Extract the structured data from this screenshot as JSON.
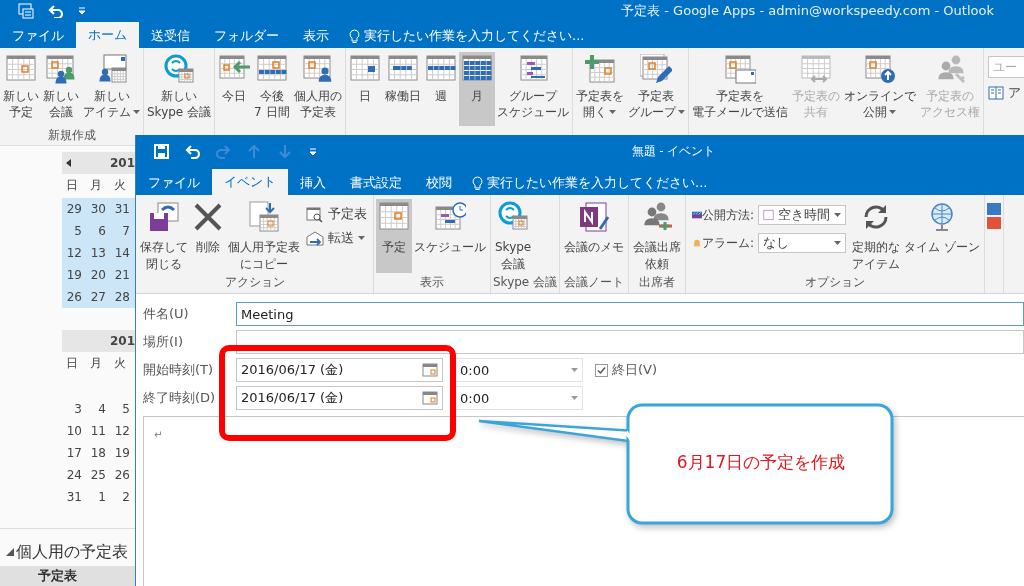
{
  "app_window": {
    "title": "予定表 - Google Apps - admin@workspeedy.com - Outlook",
    "tabs": [
      {
        "label": "ファイル",
        "selected": false
      },
      {
        "label": "ホーム",
        "selected": true
      },
      {
        "label": "送受信",
        "selected": false
      },
      {
        "label": "フォルダー",
        "selected": false
      },
      {
        "label": "表示",
        "selected": false
      }
    ],
    "tell_me": "実行したい作業を入力してください...",
    "ribbon_groups": [
      {
        "label": "新規作成",
        "buttons": [
          {
            "lines": [
              "新しい",
              "予定"
            ],
            "dropdown": false,
            "selected": false,
            "disabled": false
          },
          {
            "lines": [
              "新しい",
              "会議"
            ],
            "dropdown": false,
            "selected": false,
            "disabled": false
          },
          {
            "lines": [
              "新しい",
              "アイテム"
            ],
            "dropdown": true,
            "selected": false,
            "disabled": false
          }
        ]
      },
      {
        "buttons": [
          {
            "lines": [
              "新しい",
              "Skype 会議"
            ],
            "dropdown": false,
            "selected": false,
            "disabled": false
          }
        ]
      },
      {
        "buttons": [
          {
            "lines": [
              "今日"
            ],
            "dropdown": false,
            "selected": false,
            "disabled": false
          },
          {
            "lines": [
              "今後",
              "7 日間"
            ],
            "dropdown": false,
            "selected": false,
            "disabled": false
          },
          {
            "lines": [
              "個人用の",
              "予定表"
            ],
            "dropdown": false,
            "selected": false,
            "disabled": false
          }
        ]
      },
      {
        "buttons": [
          {
            "lines": [
              "日"
            ],
            "dropdown": false,
            "selected": false,
            "disabled": false
          },
          {
            "lines": [
              "稼働日"
            ],
            "dropdown": false,
            "selected": false,
            "disabled": false
          },
          {
            "lines": [
              "週"
            ],
            "dropdown": false,
            "selected": false,
            "disabled": false
          },
          {
            "lines": [
              "月"
            ],
            "dropdown": false,
            "selected": true,
            "disabled": false
          },
          {
            "lines": [
              "グループ",
              "スケジュール"
            ],
            "dropdown": false,
            "selected": false,
            "disabled": false
          }
        ]
      },
      {
        "buttons": [
          {
            "lines": [
              "予定表を",
              "開く"
            ],
            "dropdown": true,
            "selected": false,
            "disabled": false
          },
          {
            "lines": [
              "予定表",
              "グループ"
            ],
            "dropdown": true,
            "selected": false,
            "disabled": false
          }
        ]
      },
      {
        "buttons": [
          {
            "lines": [
              "予定表を",
              "電子メールで送信"
            ],
            "dropdown": false,
            "selected": false,
            "disabled": false
          },
          {
            "lines": [
              "予定表の",
              "共有"
            ],
            "dropdown": false,
            "selected": false,
            "disabled": true
          },
          {
            "lines": [
              "オンラインで",
              "公開"
            ],
            "dropdown": true,
            "selected": false,
            "disabled": false
          },
          {
            "lines": [
              "予定表の",
              "アクセス権"
            ],
            "dropdown": false,
            "selected": false,
            "disabled": true
          }
        ]
      }
    ],
    "search": {
      "placeholder": "ユー"
    },
    "address_book": {
      "label": "ア"
    }
  },
  "navigation": {
    "calendars": [
      {
        "header": "201",
        "weekdays": [
          "日",
          "月",
          "火"
        ],
        "blank_first_week": false,
        "highlighted": true,
        "weeks": [
          [
            "29",
            "30",
            "31"
          ],
          [
            "5",
            "6",
            "7"
          ],
          [
            "12",
            "13",
            "14"
          ],
          [
            "19",
            "20",
            "21"
          ],
          [
            "26",
            "27",
            "28"
          ]
        ]
      },
      {
        "header": "201",
        "weekdays": [
          "日",
          "月",
          "火"
        ],
        "blank_first_week": true,
        "highlighted": false,
        "weeks": [
          [
            "3",
            "4",
            "5"
          ],
          [
            "10",
            "11",
            "12"
          ],
          [
            "17",
            "18",
            "19"
          ],
          [
            "24",
            "25",
            "26"
          ],
          [
            "31",
            "1",
            "2"
          ]
        ]
      }
    ],
    "my_calendars": {
      "heading": "個人用の予定表",
      "expanded": true,
      "items": [
        {
          "label": "予定表",
          "selected": true
        }
      ]
    }
  },
  "event_window": {
    "title": "無題 - イベント",
    "quick_access": [
      {
        "disabled": false
      },
      {
        "disabled": false
      },
      {
        "disabled": true
      },
      {
        "disabled": true
      },
      {
        "disabled": true
      }
    ],
    "tabs": [
      {
        "label": "ファイル",
        "selected": false
      },
      {
        "label": "イベント",
        "selected": true
      },
      {
        "label": "挿入",
        "selected": false
      },
      {
        "label": "書式設定",
        "selected": false
      },
      {
        "label": "校閲",
        "selected": false
      }
    ],
    "tell_me": "実行したい作業を入力してください...",
    "ribbon_groups": [
      {
        "label": "アクション",
        "items": [
          {
            "kind": "large",
            "lines": [
              "保存して",
              "閉じる"
            ],
            "selected": false
          },
          {
            "kind": "large",
            "lines": [
              "削除"
            ],
            "selected": false
          },
          {
            "kind": "large",
            "lines": [
              "個人用予定表",
              "にコピー"
            ],
            "selected": false
          },
          {
            "kind": "stack",
            "buttons": [
              {
                "label": "予定表",
                "dropdown": false
              },
              {
                "label": "転送",
                "dropdown": true
              }
            ]
          }
        ]
      },
      {
        "label": "表示",
        "items": [
          {
            "kind": "large",
            "lines": [
              "予定"
            ],
            "selected": true
          },
          {
            "kind": "large",
            "lines": [
              "スケジュール"
            ],
            "selected": false
          }
        ]
      },
      {
        "label": "Skype 会議",
        "items": [
          {
            "kind": "large",
            "lines": [
              "Skype",
              "会議"
            ],
            "selected": false
          }
        ]
      },
      {
        "label": "会議ノート",
        "items": [
          {
            "kind": "large",
            "lines": [
              "会議のメモ"
            ],
            "selected": false
          }
        ]
      },
      {
        "label": "出席者",
        "items": [
          {
            "kind": "large",
            "lines": [
              "会議出席",
              "依頼"
            ],
            "selected": false
          }
        ]
      },
      {
        "label": "オプション",
        "items": [
          {
            "kind": "fields",
            "rows": [
              {
                "label": "公開方法:",
                "value": "空き時間"
              },
              {
                "label": "アラーム:",
                "value": "なし"
              }
            ]
          },
          {
            "kind": "large",
            "lines": [
              "定期的な",
              "アイテム"
            ],
            "selected": false
          },
          {
            "kind": "large",
            "lines": [
              "タイム ゾーン"
            ],
            "selected": false
          }
        ]
      }
    ],
    "form": {
      "subject": {
        "label": "件名(U)",
        "value": "Meeting"
      },
      "location": {
        "label": "場所(I)"
      },
      "start": {
        "label": "開始時刻(T)",
        "date": "2016/06/17 (金)",
        "time": "0:00"
      },
      "all_day": {
        "label": "終日(V)",
        "checked": true
      },
      "end": {
        "label": "終了時刻(D)",
        "date": "2016/06/17 (金)",
        "time": "0:00"
      }
    },
    "body_text": "↵"
  },
  "annotation": {
    "text": "6月17日の予定を作成"
  }
}
